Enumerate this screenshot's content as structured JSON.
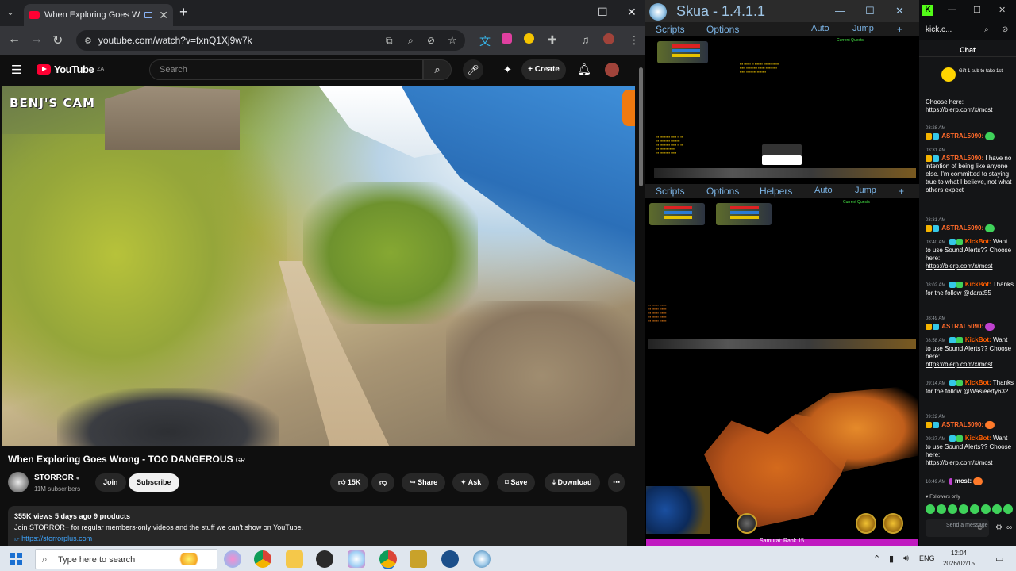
{
  "chrome": {
    "tab_title": "When Exploring Goes Wrong - TOO DANGEROUS",
    "new_tab": "+",
    "url": "youtube.com/watch?v=fxnQ1Xj9w7k",
    "win_min": "—",
    "win_max": "☐",
    "win_close": "✕"
  },
  "youtube": {
    "logo_text": "YouTube",
    "country": "ZA",
    "search_placeholder": "Search",
    "create_label": "+ Create",
    "overlay_text": "BENJ'S CAM",
    "video_title": "When Exploring Goes Wrong - TOO DANGEROUS",
    "title_suffix": "GR",
    "channel_name": "STORROR",
    "subscribers": "11M subscribers",
    "join_label": "Join",
    "subscribe_label": "Subscribe",
    "like_count": "15K",
    "share_label": "Share",
    "ask_label": "Ask",
    "save_label": "Save",
    "download_label": "Download",
    "desc_meta": "355K views  5 days ago  9 products",
    "desc_line": "Join STORROR+ for regular members-only videos and the stuff we can't show on YouTube.",
    "desc_link": "https://storrorplus.com"
  },
  "skua": {
    "title": "Skua - 1.4.1.1",
    "menu1": {
      "scripts": "Scripts",
      "options": "Options",
      "auto": "Auto",
      "jump": "Jump",
      "plus": "+"
    },
    "menu2": {
      "scripts": "Scripts",
      "options": "Options",
      "helpers": "Helpers",
      "auto": "Auto",
      "jump": "Jump",
      "plus": "+"
    },
    "quest1_title": "Current Quests",
    "quest2_title": "Current Quests",
    "rank_text": "Samurai: Rank 15"
  },
  "kick": {
    "url": "kick.c...",
    "chat_title": "Chat",
    "gift_text": "Gift 1 sub to take 1st",
    "messages": [
      {
        "time": "",
        "user": "",
        "text": "Choose here:",
        "link": "https://blerp.com/x/mcst"
      },
      {
        "time": "03:28 AM",
        "user": "ASTRAL5090:",
        "text": "",
        "link": ""
      },
      {
        "time": "03:31 AM",
        "user": "ASTRAL5090:",
        "text": "I have no intention of being like anyone else. I'm committed to staying true to what I believe, not what others expect",
        "link": ""
      },
      {
        "time": "03:31 AM",
        "user": "ASTRAL5090:",
        "text": "",
        "link": ""
      },
      {
        "time": "03:40 AM",
        "user": "KickBot:",
        "text": "Want to use Sound Alerts?? Choose here:",
        "link": "https://blerp.com/x/mcst"
      },
      {
        "time": "08:02 AM",
        "user": "KickBot:",
        "text": "Thanks for the follow @darat55",
        "link": ""
      },
      {
        "time": "08:49 AM",
        "user": "ASTRAL5090:",
        "text": "",
        "link": ""
      },
      {
        "time": "08:58 AM",
        "user": "KickBot:",
        "text": "Want to use Sound Alerts?? Choose here:",
        "link": "https://blerp.com/x/mcst"
      },
      {
        "time": "09:14 AM",
        "user": "KickBot:",
        "text": "Thanks for the follow @Wasieerty632",
        "link": ""
      },
      {
        "time": "09:22 AM",
        "user": "ASTRAL5090:",
        "text": "",
        "link": ""
      },
      {
        "time": "09:27 AM",
        "user": "KickBot:",
        "text": "Want to use Sound Alerts?? Choose here:",
        "link": "https://blerp.com/x/mcst"
      },
      {
        "time": "10:49 AM",
        "user": "mcst:",
        "text": "",
        "link": ""
      }
    ],
    "followers_only": "Followers only",
    "input_placeholder": "Send a message"
  },
  "taskbar": {
    "search_placeholder": "Type here to search",
    "lang": "ENG",
    "time": "12:04",
    "date": "2026/02/15"
  },
  "colors": {
    "youtube_red": "#ff0033",
    "kick_green": "#53fc18",
    "skua_blue": "#7ab2e3",
    "astral_name": "#ff6a2a",
    "kickbot_name": "#ff5e00",
    "mcst_name": "#ffffff"
  }
}
